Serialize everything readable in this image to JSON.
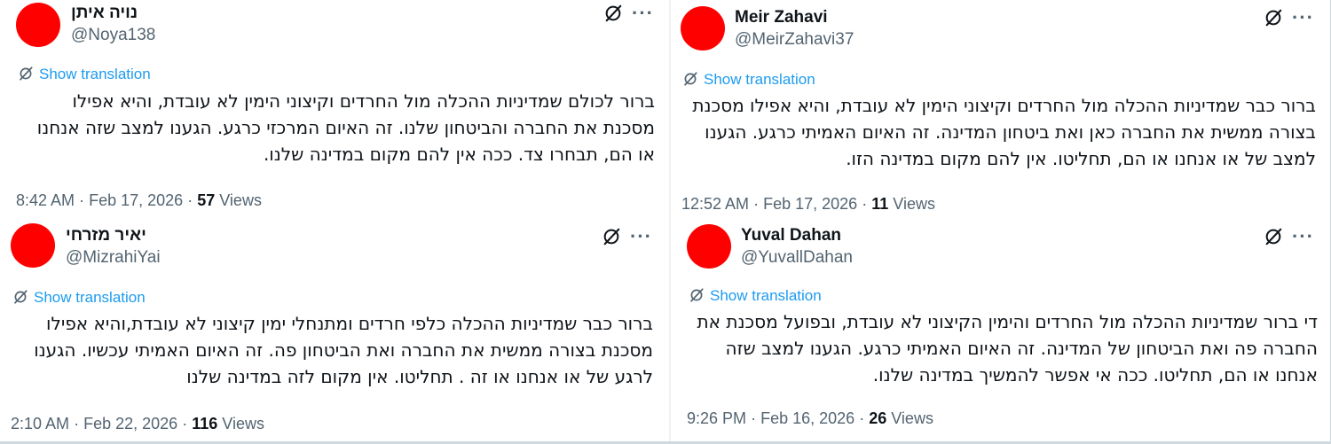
{
  "common": {
    "show_translation": "Show translation",
    "views_label": "Views",
    "more_glyph": "···",
    "dot": "·",
    "avatar_color": "#ff0000",
    "link_color": "#1d9bf0",
    "icons": [
      "grok-icon",
      "more-icon",
      "translate-icon"
    ]
  },
  "tweets": [
    {
      "name": "נויה איתן",
      "handle": "@Noya138",
      "lines": [
        "ברור לכולם שמדיניות ההכלה מול החרדים וקיצוני הימין לא עובדת, והיא אפילו",
        "מסכנת את החברה והביטחון שלנו. זה האיום המרכזי כרגע. הגענו למצב שזה אנחנו",
        "או הם, תבחרו צד. ככה אין להם מקום במדינה שלנו."
      ],
      "time": "8:42 AM",
      "date": "Feb 17, 2026",
      "views": "57"
    },
    {
      "name": "Meir Zahavi",
      "handle": "@MeirZahavi37",
      "lines": [
        "ברור כבר שמדיניות ההכלה מול החרדים וקיצוני הימין לא עובדת, והיא אפילו מסכנת",
        "בצורה ממשית את החברה כאן ואת ביטחון המדינה. זה האיום האמיתי כרגע. הגענו",
        "למצב של או אנחנו או הם, תחליטו. אין להם מקום במדינה הזו."
      ],
      "time": "12:52 AM",
      "date": "Feb 17, 2026",
      "views": "11"
    },
    {
      "name": "יאיר מזרחי",
      "handle": "@MizrahiYai",
      "lines": [
        "ברור כבר שמדיניות ההכלה כלפי חרדים ומתנחלי ימין קיצוני לא עובדת,והיא אפילו",
        "מסכנת בצורה ממשית את החברה ואת הביטחון פה. זה האיום האמיתי עכשיו. הגענו",
        "לרגע של או אנחנו או זה . תחליטו. אין מקום לזה במדינה שלנו"
      ],
      "time": "2:10 AM",
      "date": "Feb 22, 2026",
      "views": "116"
    },
    {
      "name": "Yuval Dahan",
      "handle": "@YuvallDahan",
      "lines": [
        "די ברור שמדיניות ההכלה מול החרדים והימין הקיצוני לא עובדת, ובפועל מסכנת את",
        "החברה פה ואת הביטחון של המדינה. זה האיום האמיתי כרגע. הגענו למצב שזה",
        "אנחנו או הם, תחליטו. ככה אי אפשר להמשיך במדינה שלנו."
      ],
      "time": "9:26 PM",
      "date": "Feb 16, 2026",
      "views": "26"
    }
  ]
}
